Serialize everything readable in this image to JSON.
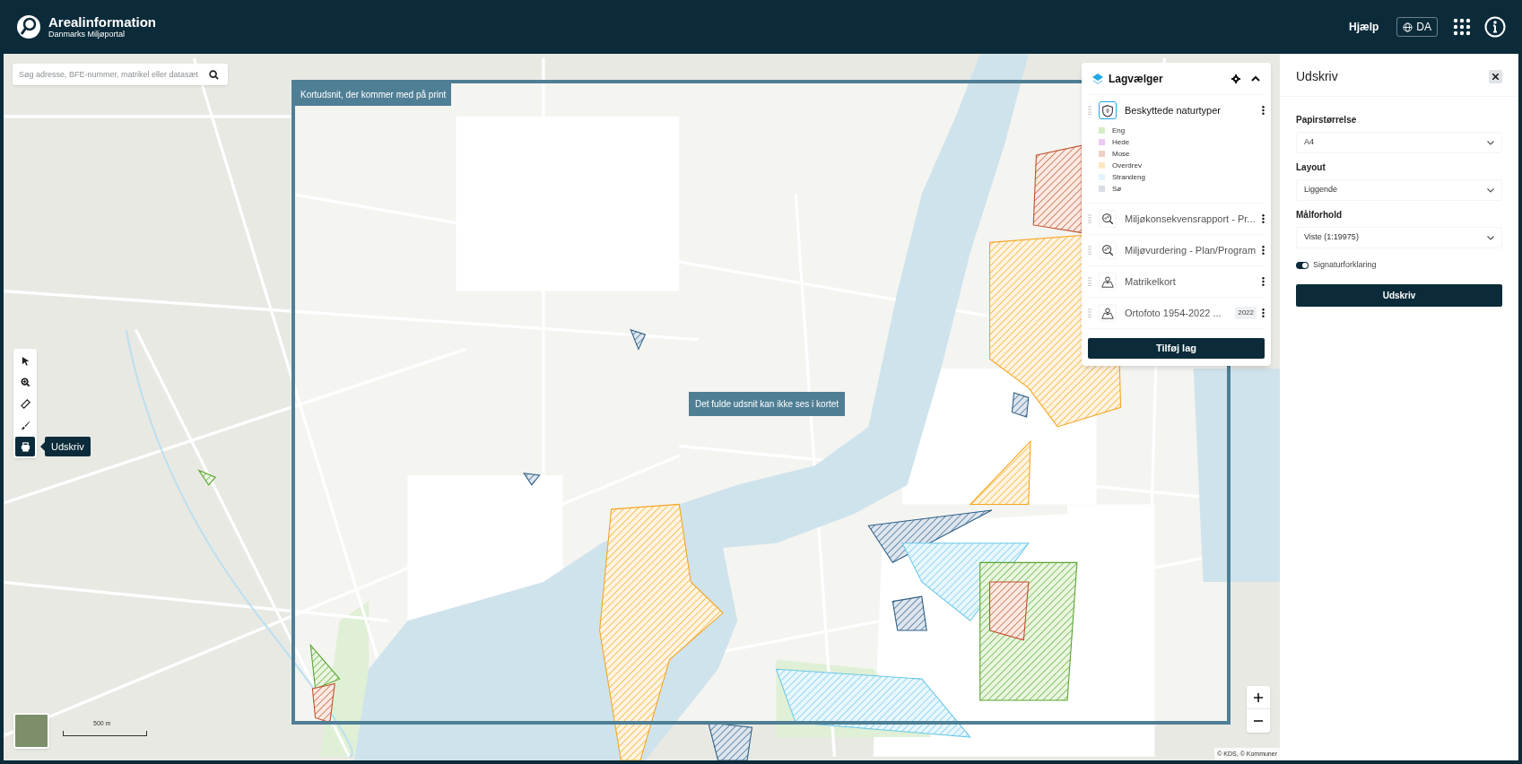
{
  "header": {
    "title": "Arealinformation",
    "subtitle": "Danmarks Miljøportal",
    "help": "Hjælp",
    "language": "DA"
  },
  "search": {
    "placeholder": "Søg adresse, BFE-nummer, matrikel eller datasæt"
  },
  "tools": [
    {
      "kind": "pointer",
      "selected": false
    },
    {
      "kind": "zoom",
      "selected": false
    },
    {
      "kind": "measure",
      "selected": false
    },
    {
      "kind": "draw",
      "selected": false
    },
    {
      "kind": "print",
      "selected": true,
      "tooltip": "Udskriv"
    }
  ],
  "print_frame": {
    "label": "Kortudsnit, der kommer med på print",
    "notice": "Det fulde udsnit kan ikke ses i kortet"
  },
  "layer_panel": {
    "title": "Lagvælger",
    "layers": [
      {
        "name": "Beskyttede naturtyper",
        "kind": "shield",
        "expanded": true,
        "legend": [
          {
            "label": "Eng",
            "color": "#d6edc4"
          },
          {
            "label": "Hede",
            "color": "#ebc9f2"
          },
          {
            "label": "Mose",
            "color": "#efd0c6"
          },
          {
            "label": "Overdrev",
            "color": "#fde7c3"
          },
          {
            "label": "Strandeng",
            "color": "#e2f4fc"
          },
          {
            "label": "Sø",
            "color": "#d8dde6"
          }
        ]
      },
      {
        "name": "Miljøkonsekvensrapport - Pr...",
        "kind": "search",
        "expanded": false
      },
      {
        "name": "Miljøvurdering - Plan/Program",
        "kind": "search",
        "expanded": false
      },
      {
        "name": "Matrikelkort",
        "kind": "map",
        "expanded": false
      },
      {
        "name": "Ortofoto 1954-2022 ...",
        "kind": "map",
        "expanded": false,
        "badge": "2022"
      }
    ],
    "add_button": "Tilføj lag"
  },
  "map": {
    "scale": "500 m",
    "attribution": "© KDS, © Kommuner"
  },
  "print_panel": {
    "title": "Udskriv",
    "fields": [
      {
        "label": "Papirstørrelse",
        "value": "A4"
      },
      {
        "label": "Layout",
        "value": "Liggende"
      },
      {
        "label": "Målforhold",
        "value": "Viste (1:19975)"
      }
    ],
    "toggle": {
      "label": "Signaturforklaring",
      "on": true
    },
    "button": "Udskriv"
  }
}
